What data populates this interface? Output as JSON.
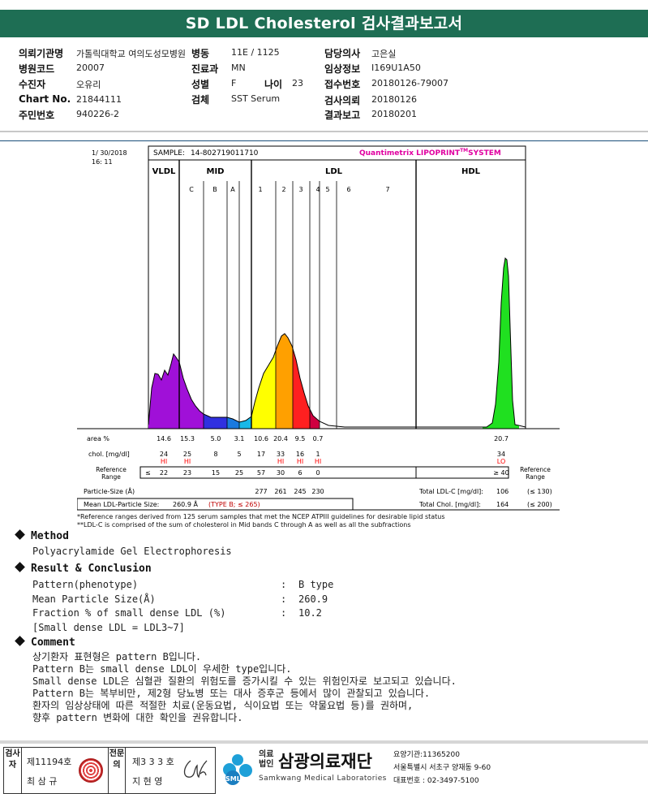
{
  "report_title": "SD LDL Cholesterol 검사결과보고서",
  "patient": {
    "col1": [
      {
        "label": "의뢰기관명",
        "value": "가톨릭대학교 여의도성모병원"
      },
      {
        "label": "병원코드",
        "value": "20007"
      },
      {
        "label": "수진자",
        "value": "오유리"
      },
      {
        "label": "Chart No.",
        "value": "21844111"
      },
      {
        "label": "주민번호",
        "value": "940226-2"
      }
    ],
    "col2": [
      {
        "label": "병동",
        "value": "11E / 1125"
      },
      {
        "label": "진료과",
        "value": "MN"
      },
      {
        "label": "성별",
        "value": "F"
      },
      {
        "label": "검체",
        "value": "SST Serum"
      }
    ],
    "age_label": "나이",
    "age_value": "23",
    "col3": [
      {
        "label": "담당의사",
        "value": "고은실"
      },
      {
        "label": "임상정보",
        "value": "I169U1A50"
      },
      {
        "label": "접수번호",
        "value": "20180126-79007"
      },
      {
        "label": "검사의뢰",
        "value": "20180126"
      },
      {
        "label": "결과보고",
        "value": "20180201"
      }
    ]
  },
  "chart_data": {
    "type": "area",
    "date": "1/ 30/2018",
    "time": "16: 11",
    "sample_label": "SAMPLE:",
    "sample_id": "14-802719011710",
    "brand": "Quantimetrix LIPOPRINT",
    "brand_tm": "TM",
    "brand_suffix": "SYSTEM",
    "regions": [
      "VLDL",
      "MID",
      "LDL",
      "HDL"
    ],
    "bands": [
      "C",
      "B",
      "A",
      "1",
      "2",
      "3",
      "4",
      "5",
      "6",
      "7"
    ],
    "area_label": "area %",
    "area": [
      "14.6",
      "15.3",
      "5.0",
      "3.1",
      "10.6",
      "20.4",
      "9.5",
      "0.7",
      "20.7"
    ],
    "chol_label": "chol. [mg/dl]",
    "chol": [
      "24",
      "25",
      "8",
      "5",
      "17",
      "33",
      "16",
      "1",
      "34"
    ],
    "flags": [
      "HI",
      "HI",
      "",
      "",
      "",
      "HI",
      "HI",
      "HI",
      "LO"
    ],
    "ref_label": "Reference Range",
    "ref_prefix": "≤",
    "ref": [
      "22",
      "23",
      "15",
      "25",
      "57",
      "30",
      "6",
      "0"
    ],
    "hdl_ref": "≥ 40",
    "particle_label": "Particle-Size (Å)",
    "particle": [
      "277",
      "261",
      "245",
      "230"
    ],
    "mean_label": "Mean LDL-Particle Size:",
    "mean_value": "260.9 Å",
    "mean_type": "(TYPE B; ≤ 265)",
    "total_ldl_label": "Total LDL-C [mg/dl]:",
    "total_ldl": "106",
    "total_ldl_ref": "(≤ 130)",
    "total_chol_label": "Total Chol. [mg/dl]:",
    "total_chol": "164",
    "total_chol_ref": "(≤ 200)",
    "notes": [
      "*Reference ranges derived from 125 serum samples that met the NCEP ATPIII guidelines for desirable lipid status",
      "**LDL-C is comprised of the sum of cholesterol in Mid bands C through A as well as all the subfractions"
    ],
    "colors": {
      "vldl": "#a010d8",
      "mid_c": "#3030e0",
      "mid_b": "#1a7ae0",
      "mid_a": "#18b8e8",
      "ldl1": "#ffff00",
      "ldl2": "#ffa000",
      "ldl3": "#ff2020",
      "ldl4": "#d00040",
      "hdl": "#20e020",
      "flag": "#ff0000",
      "brand": "#e000a0"
    }
  },
  "method": {
    "title": "Method",
    "text": "Polyacrylamide Gel Electrophoresis"
  },
  "result": {
    "title": "Result & Conclusion",
    "rows": [
      {
        "label": "Pattern(phenotype)",
        "value": "B type"
      },
      {
        "label": "Mean Particle Size(Å)",
        "value": "260.9"
      },
      {
        "label": "Fraction % of small dense LDL (%)",
        "value": "10.2"
      }
    ],
    "sep": ":",
    "note": "[Small dense LDL = LDL3~7]"
  },
  "comment": {
    "title": "Comment",
    "lines": [
      "상기환자 표현형은 pattern B입니다.",
      "Pattern B는 small dense LDL이 우세한 type입니다.",
      "Small dense LDL은 심혈관 질환의 위험도를 증가시킬 수 있는 위험인자로 보고되고 있습니다.",
      "Pattern B는 복부비만, 제2형 당뇨병 또는 대사 증후군 등에서 많이 관찰되고 있습니다.",
      "환자의 임상상태에 따른 적절한 치료(운동요법, 식이요법 또는 약물요법 등)를 권하며,",
      "향후 pattern 변화에 대한 확인을 권유합니다."
    ]
  },
  "footer": {
    "exam_cell": "검사자",
    "exam_no": "제11194호",
    "exam_name": "최 삼 규",
    "spec_cell": "전문의",
    "spec_no": "제3 3 3 호",
    "spec_name": "지 현 영",
    "org_prefix": "의료법인",
    "org_name": "삼광의료재단",
    "org_eng": "Samkwang Medical Laboratories",
    "logo_text": "SML",
    "org_code": "요양기관:11365200",
    "org_addr": "서울특별시 서초구 양재동 9-60",
    "org_tel": "대표번호 : 02-3497-5100"
  }
}
